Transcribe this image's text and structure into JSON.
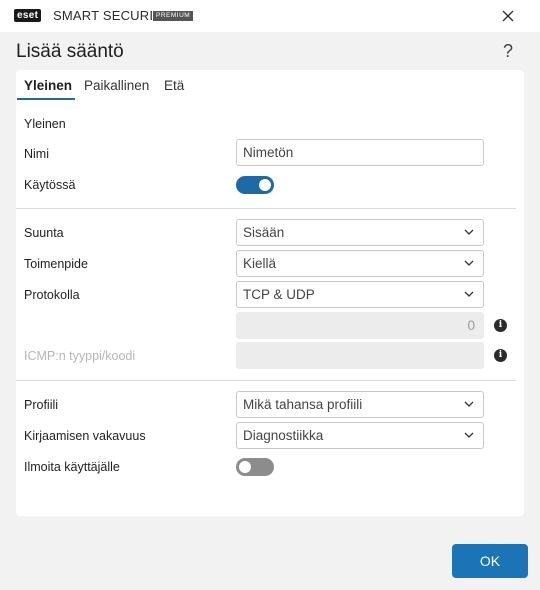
{
  "titlebar": {
    "logo": "eset",
    "product": "SMART SECURITY",
    "edition": "PREMIUM"
  },
  "dialog": {
    "title": "Lisää sääntö",
    "help": "?"
  },
  "tabs": [
    {
      "label": "Yleinen",
      "active": true
    },
    {
      "label": "Paikallinen",
      "active": false
    },
    {
      "label": "Etä",
      "active": false
    }
  ],
  "section": {
    "heading": "Yleinen"
  },
  "fields": {
    "name": {
      "label": "Nimi",
      "value": "Nimetön"
    },
    "enabled": {
      "label": "Käytössä",
      "on": true
    },
    "direction": {
      "label": "Suunta",
      "value": "Sisään"
    },
    "action": {
      "label": "Toimenpide",
      "value": "Kiellä"
    },
    "protocol": {
      "label": "Protokolla",
      "value": "TCP & UDP",
      "number_value": "0"
    },
    "icmp": {
      "label": "ICMP:n tyyppi/koodi",
      "value": ""
    },
    "profile": {
      "label": "Profiili",
      "value": "Mikä tahansa profiili"
    },
    "logging": {
      "label": "Kirjaamisen vakavuus",
      "value": "Diagnostiikka"
    },
    "notify": {
      "label": "Ilmoita käyttäjälle",
      "on": false
    }
  },
  "info_icon_glyph": "i",
  "footer": {
    "ok_label": "OK"
  },
  "colors": {
    "accent": "#1b74b5",
    "toggle_on": "#1d6aa5",
    "toggle_off": "#8c8c8c"
  }
}
